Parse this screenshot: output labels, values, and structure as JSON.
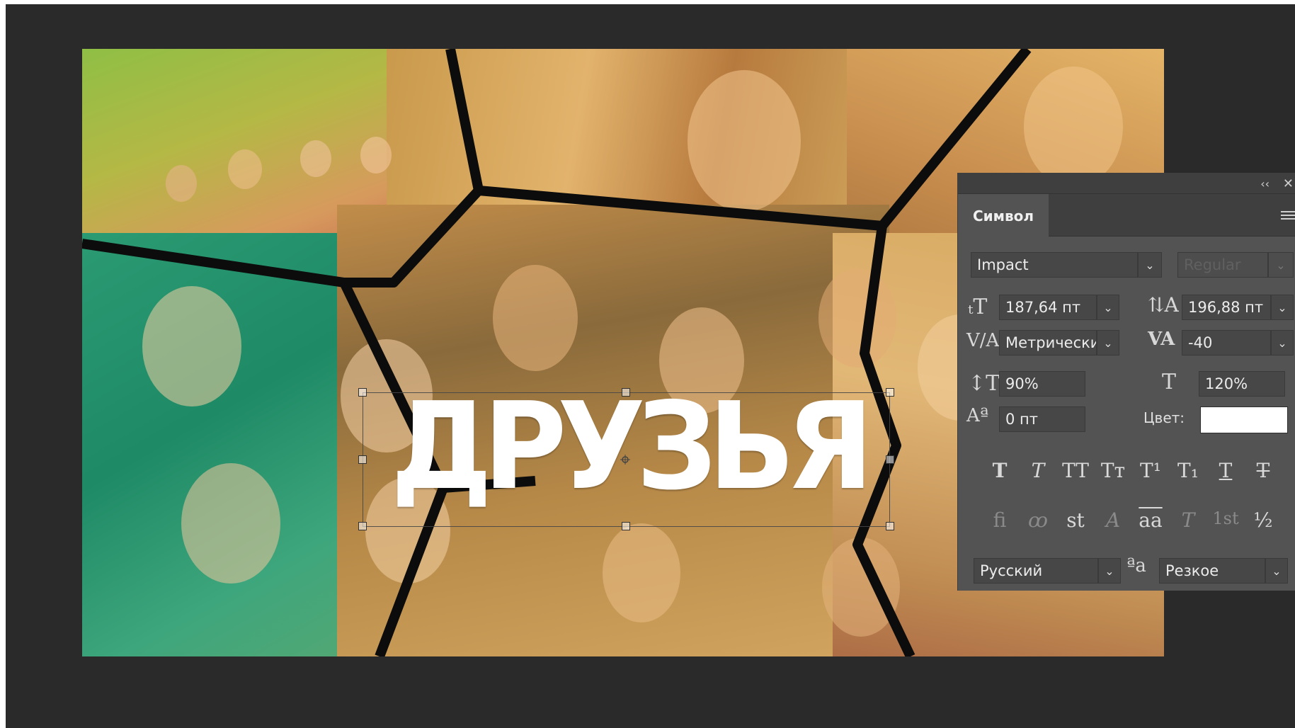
{
  "canvas": {
    "layer_text": "ДРУЗЬЯ"
  },
  "panel": {
    "tab_label": "Символ",
    "font_family": "Impact",
    "font_style_placeholder": "Regular",
    "font_size": "187,64 пт",
    "leading": "196,88 пт",
    "kerning": "Метрически",
    "tracking": "-40",
    "vertical_scale": "90%",
    "horizontal_scale": "120%",
    "baseline_shift": "0 пт",
    "color_label": "Цвет:",
    "color_value": "#ffffff",
    "language": "Русский",
    "antialias_icon_text": "ªa",
    "antialias": "Резкое",
    "style_buttons": [
      "T",
      "T",
      "TT",
      "Tт",
      "T¹",
      "T₁",
      "T",
      "T"
    ],
    "opentype_buttons": [
      "fi",
      "ꝏ",
      "st",
      "A",
      "aa",
      "T",
      "1st",
      "½"
    ]
  }
}
